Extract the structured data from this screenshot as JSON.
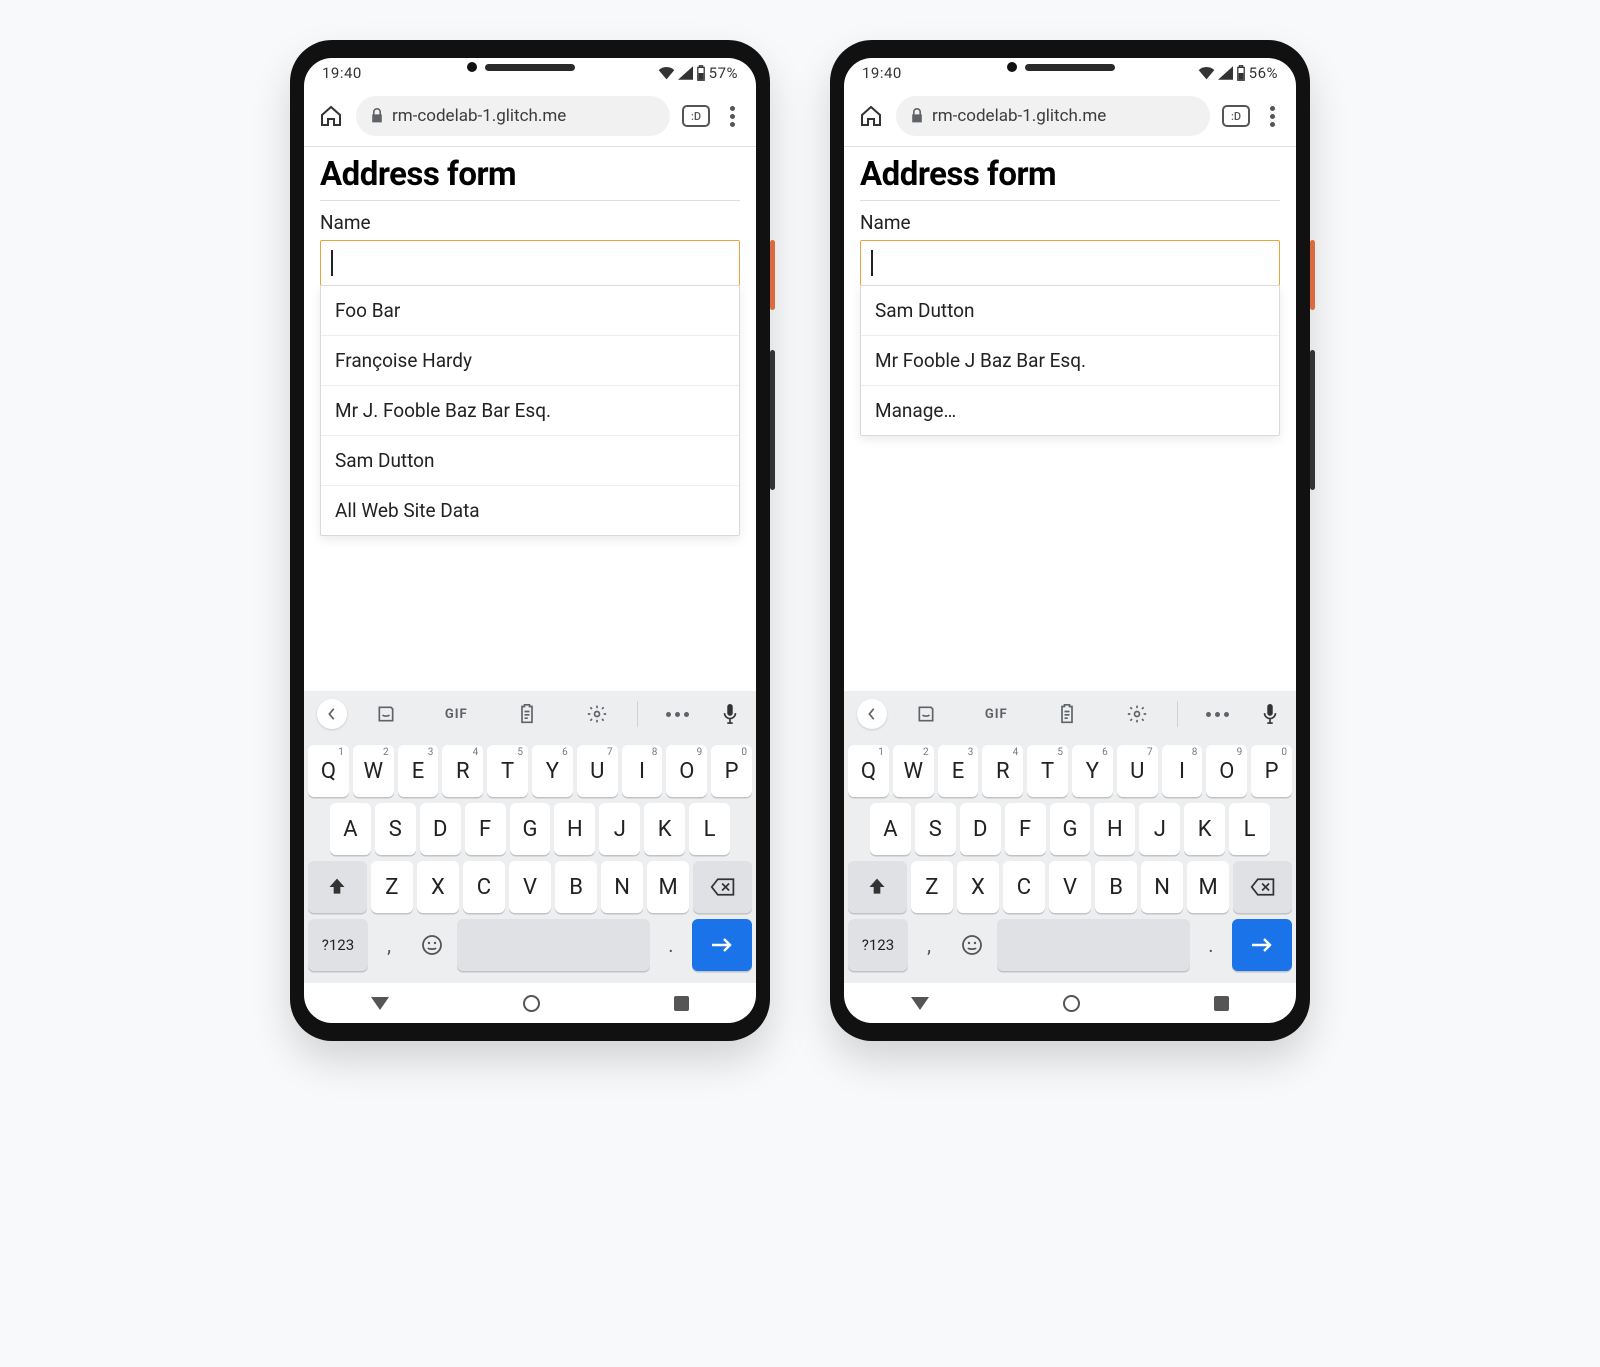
{
  "phones": [
    {
      "status": {
        "time": "19:40",
        "battery": "57%"
      },
      "url": "rm-codelab-1.glitch.me",
      "tab_count": ":D",
      "page": {
        "title": "Address form",
        "field_label": "Name",
        "input_value": ""
      },
      "suggestions": [
        "Foo Bar",
        "Françoise Hardy",
        "Mr J. Fooble Baz Bar Esq.",
        "Sam Dutton",
        "All Web Site Data"
      ]
    },
    {
      "status": {
        "time": "19:40",
        "battery": "56%"
      },
      "url": "rm-codelab-1.glitch.me",
      "tab_count": ":D",
      "page": {
        "title": "Address form",
        "field_label": "Name",
        "input_value": ""
      },
      "suggestions": [
        "Sam Dutton",
        "Mr Fooble J Baz Bar Esq.",
        "Manage…"
      ]
    }
  ],
  "keyboard": {
    "toolbar": {
      "gif": "GIF"
    },
    "row1": [
      {
        "k": "Q",
        "s": "1"
      },
      {
        "k": "W",
        "s": "2"
      },
      {
        "k": "E",
        "s": "3"
      },
      {
        "k": "R",
        "s": "4"
      },
      {
        "k": "T",
        "s": "5"
      },
      {
        "k": "Y",
        "s": "6"
      },
      {
        "k": "U",
        "s": "7"
      },
      {
        "k": "I",
        "s": "8"
      },
      {
        "k": "O",
        "s": "9"
      },
      {
        "k": "P",
        "s": "0"
      }
    ],
    "row2": [
      "A",
      "S",
      "D",
      "F",
      "G",
      "H",
      "J",
      "K",
      "L"
    ],
    "row3": [
      "Z",
      "X",
      "C",
      "V",
      "B",
      "N",
      "M"
    ],
    "sym": "?123",
    "comma": ",",
    "period": "."
  }
}
